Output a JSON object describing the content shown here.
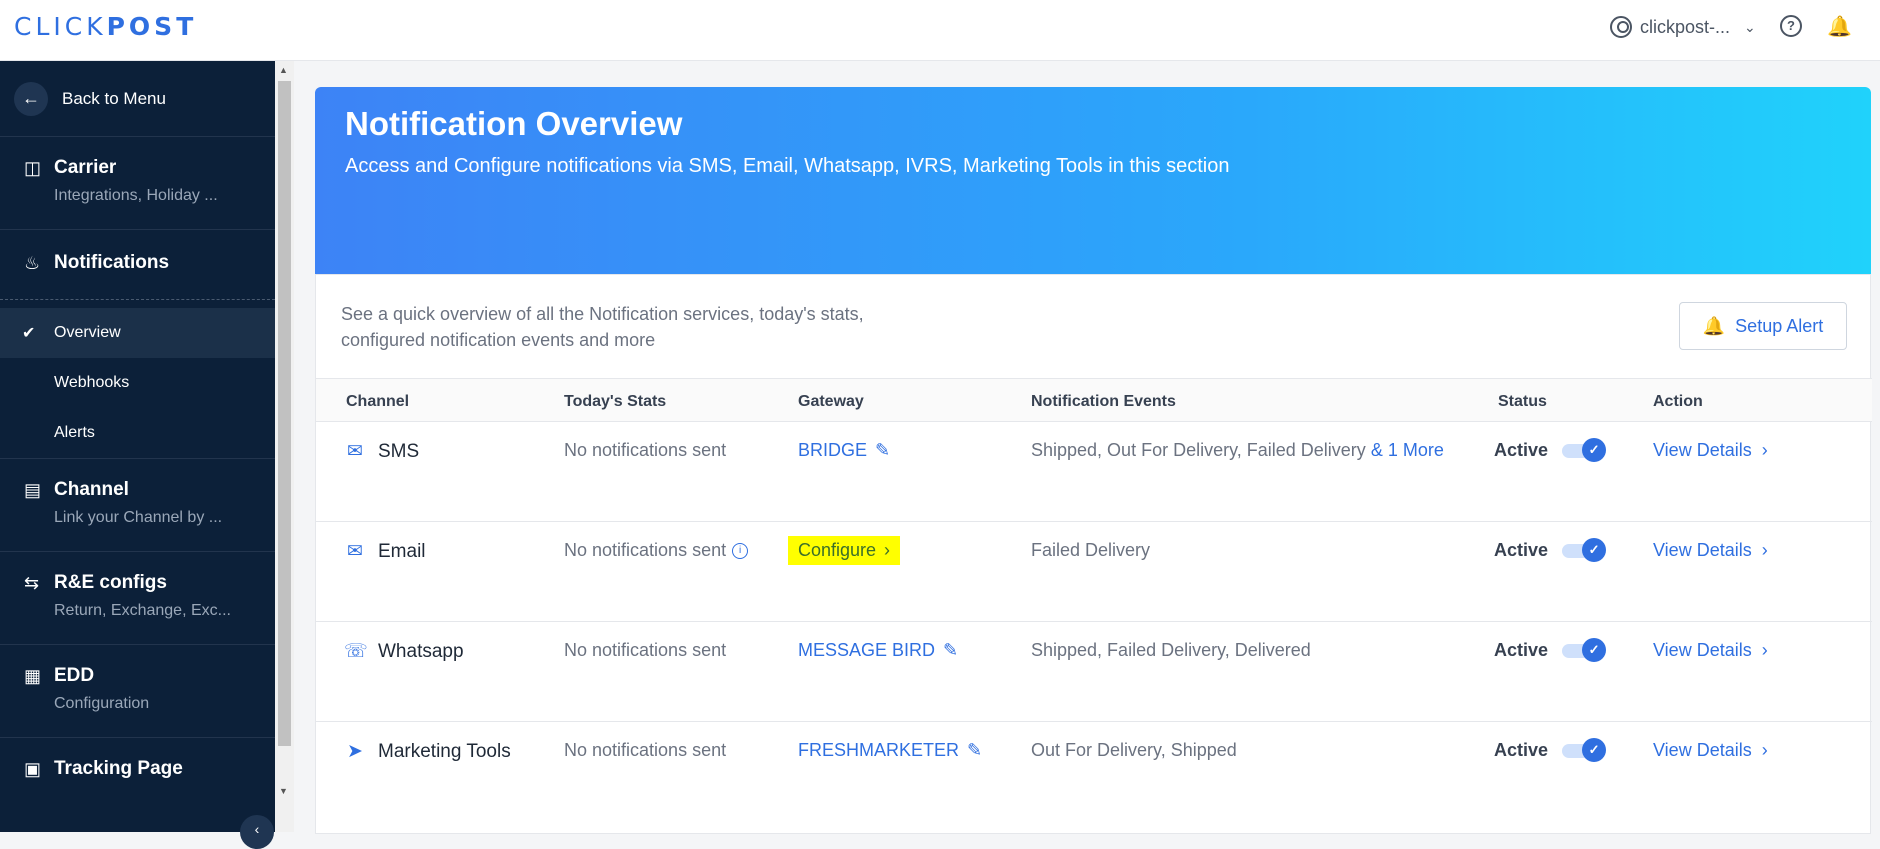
{
  "topbar": {
    "logo_part1": "CLICK",
    "logo_part2": "POST",
    "user_name": "clickpost-...",
    "icons": [
      "user-circle-icon",
      "chevron-down-icon",
      "help-icon",
      "bell-icon"
    ]
  },
  "sidebar": {
    "back_label": "Back to Menu",
    "sections": [
      {
        "title": "Carrier",
        "subtitle": "Integrations, Holiday ...",
        "icon": "carrier-icon"
      },
      {
        "title": "Notifications",
        "icon": "notification-bell-icon"
      },
      {
        "title": "Channel",
        "subtitle": "Link your Channel by ...",
        "icon": "store-icon"
      },
      {
        "title": "R&E configs",
        "subtitle": "Return, Exchange, Exc...",
        "icon": "swap-icon"
      },
      {
        "title": "EDD",
        "subtitle": "Configuration",
        "icon": "calendar-icon"
      },
      {
        "title": "Tracking Page",
        "icon": "tracking-icon"
      }
    ],
    "notification_items": [
      "Overview",
      "Webhooks",
      "Alerts"
    ],
    "active_item": "Overview"
  },
  "hero": {
    "title": "Notification Overview",
    "subtitle": "Access and Configure notifications via SMS, Email, Whatsapp, IVRS, Marketing Tools in this section"
  },
  "overview": {
    "description": "See a quick overview of all the Notification services, today's stats, configured notification events and more",
    "setup_alert_label": "Setup Alert"
  },
  "table": {
    "headers": [
      "Channel",
      "Today's Stats",
      "Gateway",
      "Notification Events",
      "Status",
      "Action"
    ],
    "rows": [
      {
        "channel": "SMS",
        "stats": "No notifications sent",
        "gateway": "BRIDGE",
        "events": "Shipped, Out For Delivery, Failed Delivery",
        "events_more": "& 1 More",
        "status": "Active",
        "action": "View Details",
        "icon": "sms-icon"
      },
      {
        "channel": "Email",
        "stats": "No notifications sent",
        "gateway": "Configure",
        "events": "Failed Delivery",
        "events_more": "",
        "status": "Active",
        "action": "View Details",
        "icon": "mail-icon"
      },
      {
        "channel": "Whatsapp",
        "stats": "No notifications sent",
        "gateway": "MESSAGE BIRD",
        "events": "Shipped, Failed Delivery, Delivered",
        "events_more": "",
        "status": "Active",
        "action": "View Details",
        "icon": "whatsapp-icon"
      },
      {
        "channel": "Marketing Tools",
        "stats": "No notifications sent",
        "gateway": "FRESHMARKETER",
        "events": "Out For Delivery, Shipped",
        "events_more": "",
        "status": "Active",
        "action": "View Details",
        "icon": "megaphone-icon"
      }
    ]
  },
  "colors": {
    "accent": "#2f6fe0",
    "sidebar": "#0c2039",
    "highlight": "#ffff00"
  }
}
